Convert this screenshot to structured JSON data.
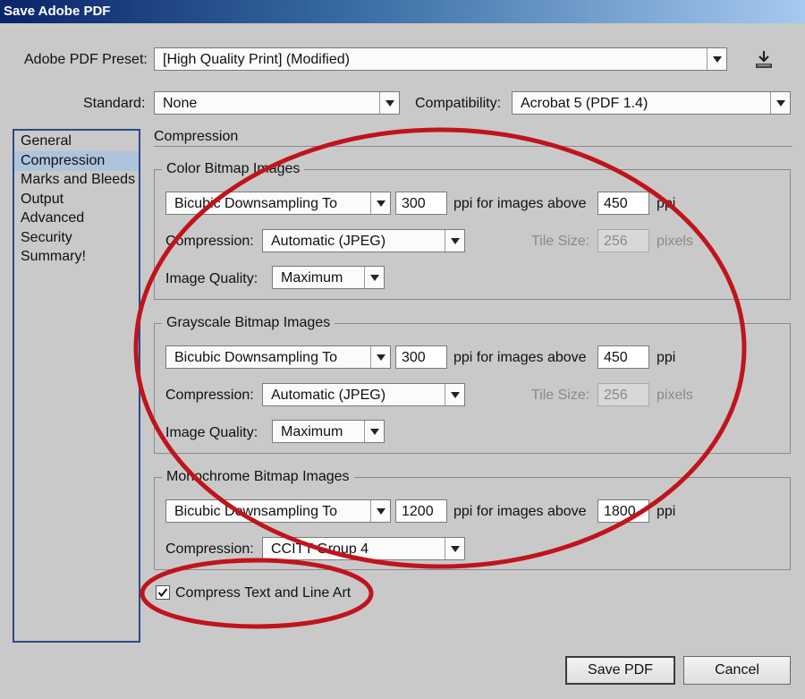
{
  "window": {
    "title": "Save Adobe PDF"
  },
  "preset": {
    "label": "Adobe PDF Preset:",
    "value": "[High Quality Print] (Modified)"
  },
  "standard": {
    "label": "Standard:",
    "value": "None"
  },
  "compatibility": {
    "label": "Compatibility:",
    "value": "Acrobat 5 (PDF 1.4)"
  },
  "sidebar": {
    "items": [
      {
        "label": "General"
      },
      {
        "label": "Compression"
      },
      {
        "label": "Marks and Bleeds"
      },
      {
        "label": "Output"
      },
      {
        "label": "Advanced"
      },
      {
        "label": "Security"
      },
      {
        "label": "Summary!"
      }
    ],
    "selected": "Compression"
  },
  "section_title": "Compression",
  "color": {
    "title": "Color Bitmap Images",
    "sampling": "Bicubic Downsampling To",
    "ppi": "300",
    "above_label": "ppi for images above",
    "above": "450",
    "ppi_unit": "ppi",
    "compression_label": "Compression:",
    "compression": "Automatic (JPEG)",
    "tile_label": "Tile Size:",
    "tile": "256",
    "tile_unit": "pixels",
    "quality_label": "Image Quality:",
    "quality": "Maximum"
  },
  "grayscale": {
    "title": "Grayscale Bitmap Images",
    "sampling": "Bicubic Downsampling To",
    "ppi": "300",
    "above_label": "ppi for images above",
    "above": "450",
    "ppi_unit": "ppi",
    "compression_label": "Compression:",
    "compression": "Automatic (JPEG)",
    "tile_label": "Tile Size:",
    "tile": "256",
    "tile_unit": "pixels",
    "quality_label": "Image Quality:",
    "quality": "Maximum"
  },
  "mono": {
    "title": "Monochrome Bitmap Images",
    "sampling": "Bicubic Downsampling To",
    "ppi": "1200",
    "above_label": "ppi for images above",
    "above": "1800",
    "ppi_unit": "ppi",
    "compression_label": "Compression:",
    "compression": "CCITT Group 4"
  },
  "compress_text": {
    "label": "Compress Text and Line Art",
    "checked": true
  },
  "buttons": {
    "save": "Save PDF",
    "cancel": "Cancel"
  },
  "colors": {
    "annotation": "#c0141c",
    "nav_border": "#2a4a8a",
    "nav_selected": "#aec3dc"
  }
}
